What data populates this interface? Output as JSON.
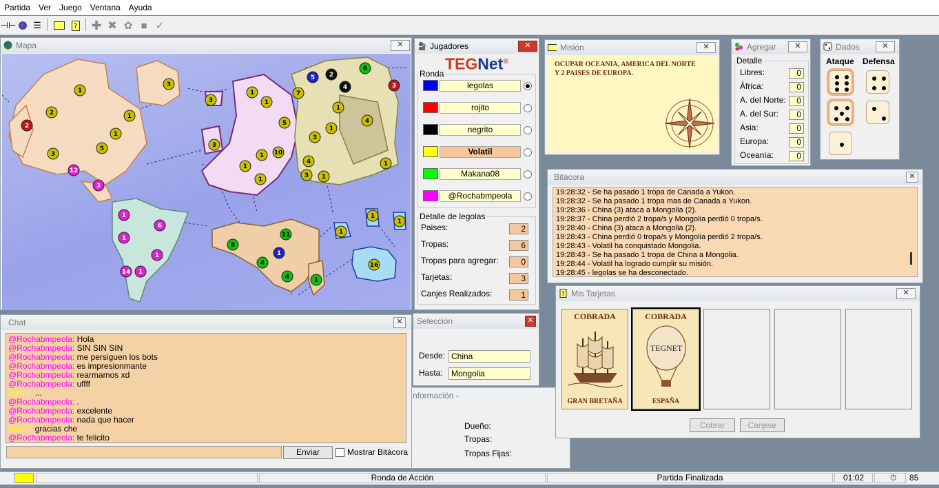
{
  "menu": [
    "Partida",
    "Ver",
    "Juego",
    "Ventana",
    "Ayuda"
  ],
  "colors": {
    "highlight": "#f5d1a6",
    "field": "#ffffcc",
    "accent_red": "#c83a2a"
  },
  "map": {
    "title": "Mapa",
    "armies": [
      "1",
      "3",
      "2",
      "1",
      "1",
      "3",
      "5",
      "2",
      "12",
      "3",
      "1",
      "6",
      "1",
      "1",
      "14",
      "1",
      "3",
      "3",
      "1",
      "10",
      "1",
      "1",
      "5",
      "1",
      "7",
      "3",
      "3",
      "4",
      "1",
      "1",
      "4",
      "1",
      "1",
      "1",
      "5",
      "2",
      "4",
      "6",
      "3",
      "8",
      "11",
      "1",
      "4",
      "4",
      "1",
      "1",
      "1",
      "1",
      "16"
    ]
  },
  "chat": {
    "title": "Chat",
    "lines": [
      {
        "user": "@Rochabmpeola",
        "color": "#ff00ff",
        "msg": " Hola"
      },
      {
        "user": "@Rochabmpeola",
        "color": "#ff00ff",
        "msg": " SIN SIN SIN"
      },
      {
        "user": "@Rochabmpeola",
        "color": "#ff00ff",
        "msg": " me persiguen los bots"
      },
      {
        "user": "@Rochabmpeola",
        "color": "#ff00ff",
        "msg": " es impresionmante"
      },
      {
        "user": "@Rochabmpeola",
        "color": "#ff00ff",
        "msg": " rearmamos xd"
      },
      {
        "user": "@Rochabmpeola",
        "color": "#ff00ff",
        "msg": " uffff"
      },
      {
        "user": "Volatil:",
        "color": "#ffff00",
        "msg": " ..."
      },
      {
        "user": "@Rochabmpeola",
        "color": "#ff00ff",
        "msg": " ."
      },
      {
        "user": "@Rochabmpeola",
        "color": "#ff00ff",
        "msg": " excelente"
      },
      {
        "user": "@Rochabmpeola",
        "color": "#ff00ff",
        "msg": " nada que hacer"
      },
      {
        "user": "Volatil:",
        "color": "#ffff00",
        "msg": " gracias che"
      },
      {
        "user": "@Rochabmpeola",
        "color": "#ff00ff",
        "msg": " te felicito"
      }
    ],
    "input_value": "",
    "send_label": "Enviar",
    "show_log_label": "Mostrar Bitácora"
  },
  "players": {
    "title": "Jugadores",
    "logo_a": "TEG",
    "logo_b": "Net",
    "logo_mark": "®",
    "round_label": "Ronda",
    "list": [
      {
        "name": "legolas",
        "color": "#0000ff",
        "active": true
      },
      {
        "name": "rojito",
        "color": "#ff0000",
        "active": false
      },
      {
        "name": "negrito",
        "color": "#000000",
        "active": false
      },
      {
        "name": "Volatil",
        "color": "#ffff00",
        "active": false
      },
      {
        "name": "Makana08",
        "color": "#00ff00",
        "active": false
      },
      {
        "name": "@Rochabmpeola",
        "color": "#ff00ff",
        "active": false
      }
    ],
    "detail_title": "Detalle de legolas",
    "details": [
      {
        "label": "Paises:",
        "value": "2"
      },
      {
        "label": "Tropas:",
        "value": "6"
      },
      {
        "label": "Tropas para agregar:",
        "value": "0"
      },
      {
        "label": "Tarjetas:",
        "value": "3"
      },
      {
        "label": "Canjes Realizados:",
        "value": "1"
      }
    ]
  },
  "selection": {
    "title": "Selección",
    "from_label": "Desde:",
    "from_value": "China",
    "to_label": "Hasta:",
    "to_value": "Mongolia"
  },
  "info": {
    "title": "nformación -",
    "owner_label": "Dueño:",
    "troops_label": "Tropas:",
    "fixed_label": "Tropas Fijas:"
  },
  "mission": {
    "title": "Misión",
    "text": "OCUPAR OCEANIA, AMERICA DEL NORTE Y 2 PAISES DE EUROPA."
  },
  "add": {
    "title": "Agregar",
    "detail_label": "Detalle",
    "rows": [
      {
        "label": "Libres:",
        "value": "0"
      },
      {
        "label": "África:",
        "value": "0"
      },
      {
        "label": "A. del Norte:",
        "value": "0"
      },
      {
        "label": "A. del Sur:",
        "value": "0"
      },
      {
        "label": "Asia:",
        "value": "0"
      },
      {
        "label": "Europa:",
        "value": "0"
      },
      {
        "label": "Oceanía:",
        "value": "0"
      }
    ]
  },
  "dice": {
    "title": "Dados",
    "attack_label": "Ataque",
    "defense_label": "Defensa",
    "attack": [
      6,
      5,
      1
    ],
    "defense": [
      4,
      2
    ]
  },
  "log": {
    "title": "Bitácora",
    "lines": [
      "19:28:32 - Se ha pasado 1 tropa de Canada a Yukon.",
      "19:28:32 - Se ha pasado 1 tropa mas de Canada a Yukon.",
      "19:28:36 - China (3) ataca a Mongolia (2).",
      "19:28:37 - China perdió 2 tropa/s y Mongolia perdió 0 tropa/s.",
      "19:28:40 - China (3) ataca a Mongolia (2).",
      "19:28:43 - China perdió 0 tropa/s y Mongolia perdió 2 tropa/s.",
      "19:28:43 - Volatil ha conquistado Mongolia.",
      "19:28:43 - Se ha pasado 1 tropa de China a Mongolia.",
      "19:28:44 - Volatil ha logrado cumplir su misión.",
      "19:28:45 - legolas se ha desconectado."
    ]
  },
  "cards": {
    "title": "Mis Tarjetas",
    "items": [
      {
        "status": "COBRADA",
        "country": "GRAN BRETAÑA",
        "image": "ship"
      },
      {
        "status": "COBRADA",
        "country": "ESPAÑA",
        "image": "balloon",
        "inner": "TEGNET"
      }
    ],
    "collect_label": "Cobrar",
    "exchange_label": "Canjear"
  },
  "status": {
    "phase": "Ronda de Acción",
    "state": "Partida Finalizada",
    "time": "01:02",
    "count": "85"
  }
}
